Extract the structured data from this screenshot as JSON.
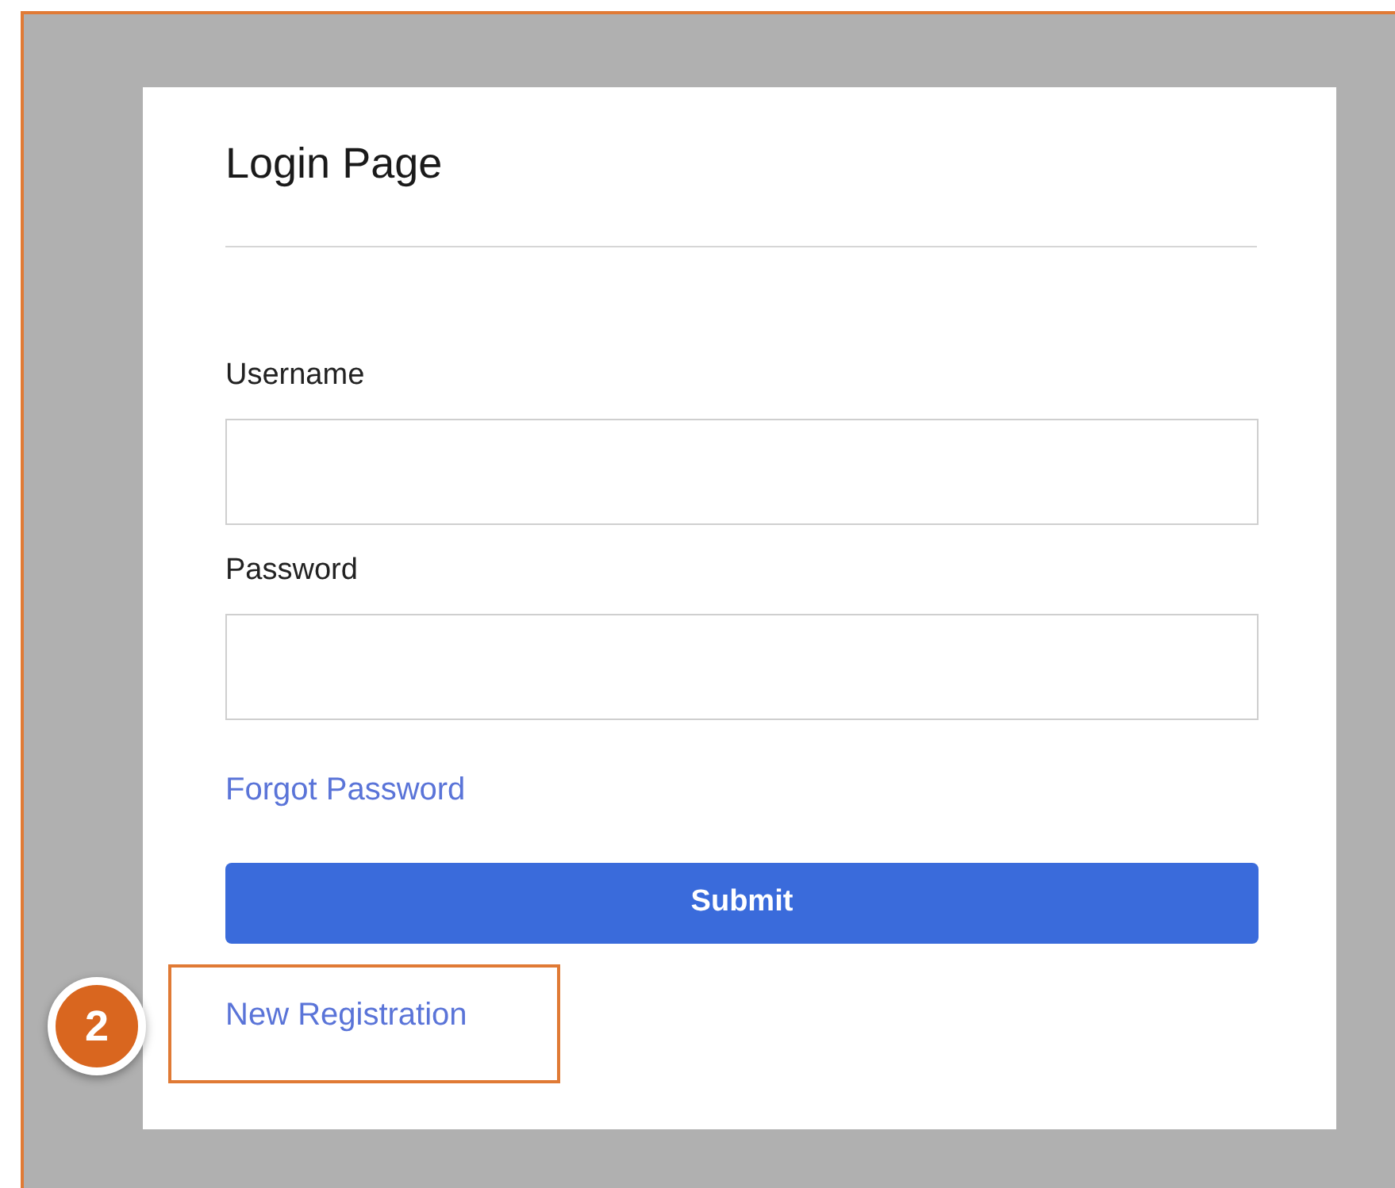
{
  "card": {
    "title": "Login Page"
  },
  "fields": [
    {
      "label": "Username"
    },
    {
      "label": "Password"
    }
  ],
  "forgot_link": "Forgot Password",
  "submit_button": "Submit",
  "registration_link": "New Registration",
  "annotation": {
    "badge": "2"
  }
}
